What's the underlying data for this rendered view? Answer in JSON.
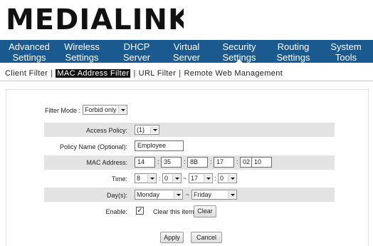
{
  "brand": {
    "name": "MEDIALINK"
  },
  "nav": {
    "items": [
      {
        "line1": "Advanced",
        "line2": "Settings"
      },
      {
        "line1": "Wireless",
        "line2": "Settings"
      },
      {
        "line1": "DHCP",
        "line2": "Server"
      },
      {
        "line1": "Virtual",
        "line2": "Server"
      },
      {
        "line1": "Security",
        "line2": "Settings"
      },
      {
        "line1": "Routing",
        "line2": "Settings"
      },
      {
        "line1": "System",
        "line2": "Tools"
      }
    ],
    "active_index": 4,
    "background": "#1a5a8e"
  },
  "subnav": {
    "items": [
      "Client Filter",
      "MAC Address Filter",
      "URL Filter",
      "Remote Web Management"
    ],
    "separator": "|",
    "active_index": 1
  },
  "form": {
    "filter_mode": {
      "label": "Filter Mode :",
      "value": "Forbid only"
    },
    "access_policy": {
      "label": "Access Policy:",
      "value": "(1)"
    },
    "policy_name": {
      "label": "Policy Name (Optional):",
      "value": "Employee"
    },
    "mac_address": {
      "label": "MAC Address:",
      "octets": [
        "14",
        "35",
        "8B",
        "17",
        "02",
        "10"
      ],
      "separator": ":"
    },
    "time": {
      "label": "Time:",
      "start_hour": "8",
      "start_min": "0",
      "end_hour": "17",
      "end_min": "0",
      "colon": ":",
      "range_sep": "~"
    },
    "days": {
      "label": "Day(s):",
      "start": "Monday",
      "end": "Friday",
      "range_sep": "~"
    },
    "enable": {
      "label": "Enable:",
      "checked": true,
      "check_mark": "✓",
      "clear_text": "Clear this item:",
      "clear_button": "Clear"
    },
    "apply_button": "Apply",
    "cancel_button": "Cancel"
  },
  "colors": {
    "band": "#e3e3e3",
    "active_sub": "#111111"
  }
}
